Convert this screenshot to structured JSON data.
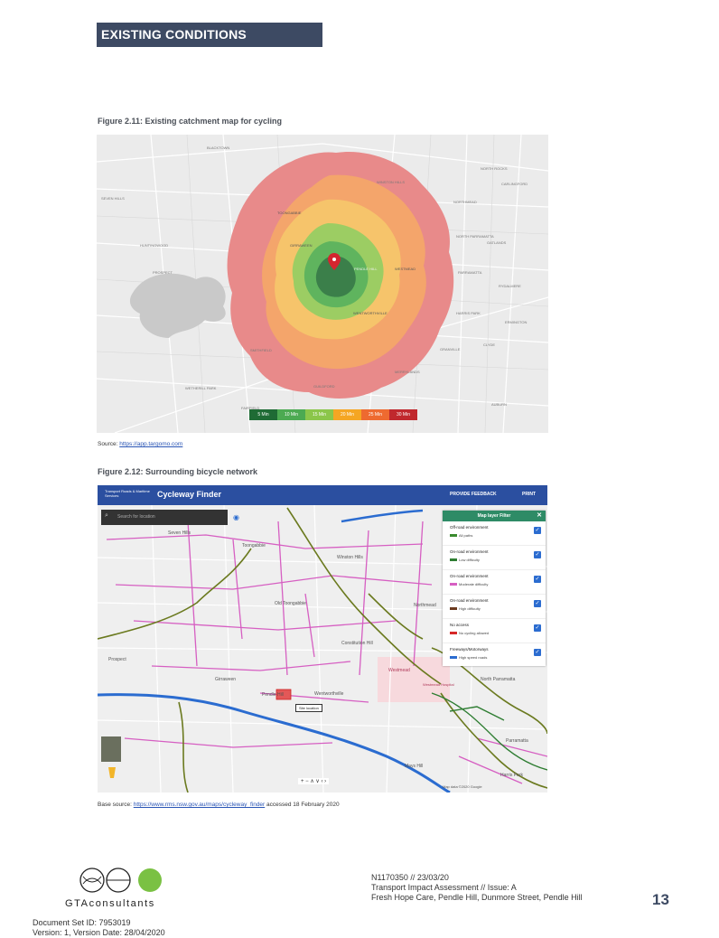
{
  "header": {
    "section_title": "EXISTING CONDITIONS"
  },
  "figure1": {
    "caption": "Figure 2.11: Existing catchment map for cycling",
    "map_labels": [
      "BLACKTOWN",
      "SEVEN HILLS",
      "NORTHMEAD",
      "WINSTON HILLS",
      "NORTH ROCKS",
      "HUNTINGWOOD",
      "NORTH PARRAMATTA",
      "OATLANDS",
      "PROSPECT",
      "GIRRAWEEN",
      "PENDLE HILL",
      "WESTMEAD",
      "PARRAMATTA",
      "HARRIS PARK",
      "GRANVILLE",
      "MERRYLANDS",
      "GUILDFORD",
      "WETHERILL PARK",
      "FAIRFIELD",
      "AUBURN",
      "CLYDE",
      "RYDALMERE",
      "ERMINGTON",
      "SMITHFIELD",
      "WENTWORTHVILLE",
      "TOONGABBIE",
      "CARLINGFORD",
      "PENDLE HILL"
    ],
    "legend": [
      {
        "label": "5 Min",
        "color": "#1f6b35"
      },
      {
        "label": "10 Min",
        "color": "#4caa52"
      },
      {
        "label": "15 Min",
        "color": "#8bc64a"
      },
      {
        "label": "20 Min",
        "color": "#f5a623"
      },
      {
        "label": "25 Min",
        "color": "#ee6a30"
      },
      {
        "label": "30 Min",
        "color": "#c0282d"
      }
    ],
    "source_label": "Source: ",
    "source_link": "https://app.targomo.com"
  },
  "figure2": {
    "caption": "Figure 2.12: Surrounding bicycle network",
    "app_org": "Transport Roads & Maritime Services",
    "app_title": "Cycleway Finder",
    "feedback_label": "PROVIDE FEEDBACK",
    "print_label": "PRINT",
    "search_placeholder": "Search for location",
    "filter_title": "Map layer Filter",
    "layers": [
      {
        "name": "Off-road environment",
        "item": "All paths",
        "color": "#3a8a2e"
      },
      {
        "name": "On-road environment",
        "item": "Low difficulty",
        "color": "#2e7d32"
      },
      {
        "name": "On-road environment",
        "item": "Moderate difficulty",
        "color": "#d65fc2"
      },
      {
        "name": "On-road environment",
        "item": "High difficulty",
        "color": "#6b3a1f"
      },
      {
        "name": "No access",
        "item": "No cycling allowed",
        "color": "#d62828"
      },
      {
        "name": "Freeways/Motorways",
        "item": "High speed roads",
        "color": "#2b6cd0"
      }
    ],
    "site_label": "Site location",
    "map_labels": [
      "Seven Hills",
      "Winston Hills",
      "Old Toongabbie",
      "Constitution Hill",
      "Prospect",
      "Girraween",
      "Pendle Hill",
      "Wentworthville",
      "Westmead",
      "Westmead Hospital",
      "North Parramatta",
      "Parramatta",
      "Mays Hill",
      "Harris Park",
      "Toongabbie",
      "Northmead"
    ],
    "map_attribution": "Map data ©2020 Google",
    "base_source_label": "Base source: ",
    "base_source_link": "https://www.rms.nsw.gov.au/maps/cycleway_finder",
    "base_source_suffix": " accessed 18 February 2020"
  },
  "footer": {
    "logo_text": "GTAconsultants",
    "ref_line": "N1170350 // 23/03/20",
    "report_line": "Transport Impact Assessment  // Issue: A",
    "project_line": "Fresh Hope Care, Pendle Hill, Dunmore Street, Pendle Hill",
    "page_number": "13",
    "doc_set": "Document Set ID: 7953019",
    "version": "Version: 1, Version Date: 28/04/2020"
  }
}
